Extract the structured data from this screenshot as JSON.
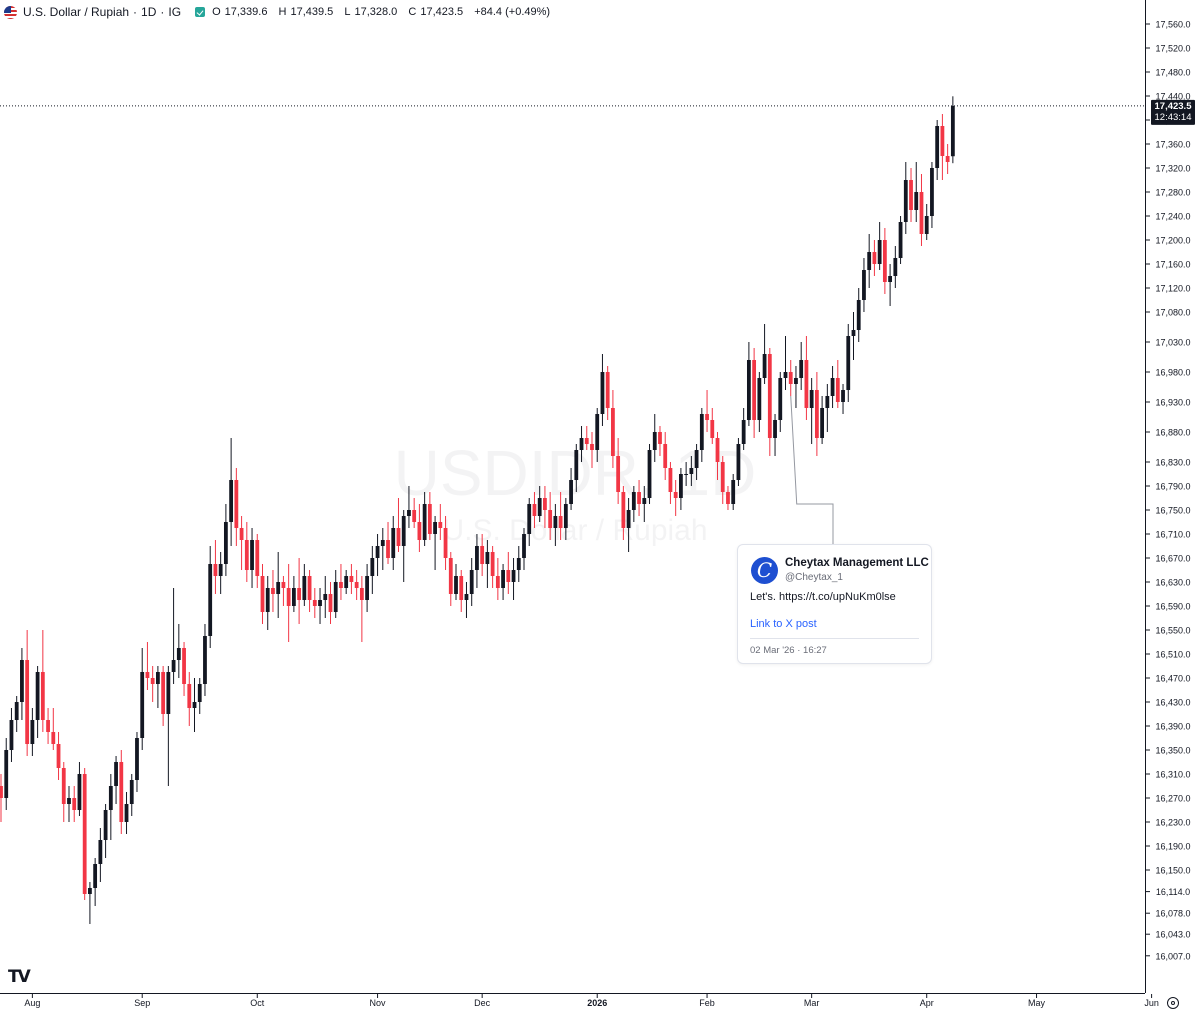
{
  "header": {
    "symbol_title": "U.S. Dollar / Rupiah",
    "interval": "1D",
    "exchange": "IG",
    "separator": "·",
    "ohlc": {
      "open_label": "O",
      "open": "17,339.6",
      "high_label": "H",
      "high": "17,439.5",
      "low_label": "L",
      "low": "17,328.0",
      "close_label": "C",
      "close": "17,423.5",
      "change": "+84.4 (+0.49%)"
    }
  },
  "watermark": {
    "symbol": "USDIDR, 1D",
    "name": "U.S. Dollar / Rupiah"
  },
  "price_label": {
    "price": "17,423.5",
    "countdown": "12:43:14"
  },
  "colors": {
    "up": "#131722",
    "down": "#f23645",
    "text": "#131722",
    "grid_axis": "#131722"
  },
  "tweet": {
    "author": "Cheytax Management LLC",
    "handle": "@Cheytax_1",
    "text": "Let's. https://t.co/upNuKm0lse",
    "link_text": "Link to X post",
    "timestamp": "02 Mar '26 · 16:27",
    "anchor_index": 151,
    "icon": "profile-c-logo"
  },
  "branding": {
    "logo_text": "TV"
  },
  "chart_data": {
    "type": "candlestick",
    "title": "U.S. Dollar / Rupiah · 1D · IG",
    "ylim": [
      15980,
      17580
    ],
    "y_scale": "linear",
    "y_ticks": [
      "17,560.0",
      "17,520.0",
      "17,480.0",
      "17,440.0",
      "17,400.0",
      "17,360.0",
      "17,320.0",
      "17,280.0",
      "17,240.0",
      "17,200.0",
      "17,160.0",
      "17,120.0",
      "17,080.0",
      "17,030.0",
      "16,980.0",
      "16,930.0",
      "16,880.0",
      "16,830.0",
      "16,790.0",
      "16,750.0",
      "16,710.0",
      "16,670.0",
      "16,630.0",
      "16,590.0",
      "16,550.0",
      "16,510.0",
      "16,470.0",
      "16,430.0",
      "16,390.0",
      "16,350.0",
      "16,310.0",
      "16,270.0",
      "16,230.0",
      "16,190.0",
      "16,150.0",
      "16,114.0",
      "16,078.0",
      "16,043.0",
      "16,007.0"
    ],
    "x_labels": [
      {
        "label": "Aug",
        "index": 6
      },
      {
        "label": "Sep",
        "index": 27
      },
      {
        "label": "Oct",
        "index": 49
      },
      {
        "label": "Nov",
        "index": 72
      },
      {
        "label": "Dec",
        "index": 92
      },
      {
        "label": "2026",
        "index": 114
      },
      {
        "label": "Feb",
        "index": 135
      },
      {
        "label": "Mar",
        "index": 155
      },
      {
        "label": "Apr",
        "index": 177
      },
      {
        "label": "May",
        "index": 198
      },
      {
        "label": "Jun",
        "index": 220
      }
    ],
    "grid": false,
    "last_price": 17423.5,
    "candles": [
      [
        16290,
        16310,
        16230,
        16270
      ],
      [
        16270,
        16370,
        16250,
        16350
      ],
      [
        16350,
        16420,
        16330,
        16400
      ],
      [
        16400,
        16440,
        16380,
        16430
      ],
      [
        16430,
        16520,
        16400,
        16500
      ],
      [
        16500,
        16550,
        16340,
        16360
      ],
      [
        16360,
        16420,
        16340,
        16400
      ],
      [
        16400,
        16490,
        16370,
        16480
      ],
      [
        16480,
        16550,
        16380,
        16400
      ],
      [
        16400,
        16420,
        16360,
        16380
      ],
      [
        16380,
        16420,
        16350,
        16360
      ],
      [
        16360,
        16380,
        16300,
        16320
      ],
      [
        16320,
        16330,
        16230,
        16260
      ],
      [
        16260,
        16290,
        16230,
        16270
      ],
      [
        16270,
        16290,
        16230,
        16250
      ],
      [
        16250,
        16330,
        16240,
        16310
      ],
      [
        16310,
        16320,
        16100,
        16110
      ],
      [
        16110,
        16130,
        16060,
        16120
      ],
      [
        16120,
        16170,
        16090,
        16160
      ],
      [
        16160,
        16220,
        16130,
        16200
      ],
      [
        16200,
        16260,
        16170,
        16250
      ],
      [
        16250,
        16310,
        16200,
        16290
      ],
      [
        16290,
        16340,
        16260,
        16330
      ],
      [
        16330,
        16350,
        16210,
        16230
      ],
      [
        16230,
        16280,
        16210,
        16260
      ],
      [
        16260,
        16310,
        16240,
        16300
      ],
      [
        16300,
        16380,
        16280,
        16370
      ],
      [
        16370,
        16520,
        16350,
        16480
      ],
      [
        16480,
        16530,
        16450,
        16470
      ],
      [
        16470,
        16490,
        16430,
        16460
      ],
      [
        16460,
        16490,
        16420,
        16480
      ],
      [
        16480,
        16490,
        16390,
        16410
      ],
      [
        16410,
        16490,
        16290,
        16480
      ],
      [
        16480,
        16620,
        16460,
        16500
      ],
      [
        16500,
        16560,
        16470,
        16520
      ],
      [
        16520,
        16530,
        16440,
        16460
      ],
      [
        16460,
        16480,
        16390,
        16420
      ],
      [
        16420,
        16470,
        16380,
        16430
      ],
      [
        16430,
        16470,
        16410,
        16460
      ],
      [
        16460,
        16560,
        16440,
        16540
      ],
      [
        16540,
        16690,
        16520,
        16660
      ],
      [
        16660,
        16700,
        16610,
        16640
      ],
      [
        16640,
        16680,
        16610,
        16660
      ],
      [
        16660,
        16760,
        16640,
        16730
      ],
      [
        16730,
        16870,
        16690,
        16800
      ],
      [
        16800,
        16820,
        16690,
        16720
      ],
      [
        16720,
        16740,
        16650,
        16700
      ],
      [
        16700,
        16730,
        16630,
        16650
      ],
      [
        16650,
        16720,
        16620,
        16700
      ],
      [
        16700,
        16710,
        16620,
        16640
      ],
      [
        16640,
        16660,
        16560,
        16580
      ],
      [
        16580,
        16640,
        16550,
        16620
      ],
      [
        16620,
        16650,
        16580,
        16610
      ],
      [
        16610,
        16680,
        16570,
        16630
      ],
      [
        16630,
        16640,
        16590,
        16620
      ],
      [
        16620,
        16660,
        16530,
        16590
      ],
      [
        16590,
        16640,
        16580,
        16620
      ],
      [
        16620,
        16670,
        16560,
        16600
      ],
      [
        16600,
        16660,
        16590,
        16640
      ],
      [
        16640,
        16650,
        16580,
        16600
      ],
      [
        16600,
        16620,
        16570,
        16590
      ],
      [
        16590,
        16620,
        16560,
        16600
      ],
      [
        16600,
        16640,
        16570,
        16610
      ],
      [
        16610,
        16630,
        16560,
        16580
      ],
      [
        16580,
        16650,
        16570,
        16630
      ],
      [
        16630,
        16660,
        16600,
        16620
      ],
      [
        16620,
        16650,
        16610,
        16640
      ],
      [
        16640,
        16660,
        16610,
        16630
      ],
      [
        16630,
        16650,
        16600,
        16620
      ],
      [
        16620,
        16640,
        16530,
        16600
      ],
      [
        16600,
        16660,
        16580,
        16640
      ],
      [
        16640,
        16690,
        16610,
        16670
      ],
      [
        16670,
        16710,
        16640,
        16690
      ],
      [
        16690,
        16720,
        16650,
        16700
      ],
      [
        16700,
        16730,
        16660,
        16670
      ],
      [
        16670,
        16740,
        16650,
        16720
      ],
      [
        16720,
        16770,
        16680,
        16690
      ],
      [
        16690,
        16750,
        16630,
        16740
      ],
      [
        16740,
        16790,
        16720,
        16750
      ],
      [
        16750,
        16770,
        16720,
        16730
      ],
      [
        16730,
        16760,
        16680,
        16700
      ],
      [
        16700,
        16780,
        16690,
        16760
      ],
      [
        16760,
        16780,
        16700,
        16710
      ],
      [
        16710,
        16740,
        16650,
        16730
      ],
      [
        16730,
        16760,
        16700,
        16720
      ],
      [
        16720,
        16740,
        16650,
        16670
      ],
      [
        16670,
        16680,
        16590,
        16610
      ],
      [
        16610,
        16660,
        16600,
        16640
      ],
      [
        16640,
        16650,
        16580,
        16600
      ],
      [
        16600,
        16630,
        16570,
        16610
      ],
      [
        16610,
        16670,
        16590,
        16650
      ],
      [
        16650,
        16710,
        16620,
        16690
      ],
      [
        16690,
        16710,
        16640,
        16660
      ],
      [
        16660,
        16700,
        16620,
        16680
      ],
      [
        16680,
        16690,
        16620,
        16640
      ],
      [
        16640,
        16670,
        16600,
        16620
      ],
      [
        16620,
        16660,
        16600,
        16650
      ],
      [
        16650,
        16680,
        16610,
        16630
      ],
      [
        16630,
        16670,
        16600,
        16650
      ],
      [
        16650,
        16690,
        16630,
        16670
      ],
      [
        16670,
        16720,
        16650,
        16710
      ],
      [
        16710,
        16770,
        16690,
        16760
      ],
      [
        16760,
        16780,
        16720,
        16740
      ],
      [
        16740,
        16790,
        16730,
        16770
      ],
      [
        16770,
        16790,
        16720,
        16750
      ],
      [
        16750,
        16780,
        16700,
        16720
      ],
      [
        16720,
        16760,
        16690,
        16740
      ],
      [
        16740,
        16780,
        16700,
        16720
      ],
      [
        16720,
        16770,
        16700,
        16760
      ],
      [
        16760,
        16820,
        16750,
        16800
      ],
      [
        16800,
        16860,
        16780,
        16850
      ],
      [
        16850,
        16890,
        16830,
        16870
      ],
      [
        16870,
        16890,
        16850,
        16860
      ],
      [
        16860,
        16880,
        16820,
        16850
      ],
      [
        16850,
        16920,
        16830,
        16910
      ],
      [
        16910,
        17010,
        16890,
        16980
      ],
      [
        16980,
        16990,
        16900,
        16920
      ],
      [
        16920,
        16950,
        16820,
        16840
      ],
      [
        16840,
        16870,
        16760,
        16780
      ],
      [
        16780,
        16790,
        16700,
        16720
      ],
      [
        16720,
        16770,
        16680,
        16750
      ],
      [
        16750,
        16790,
        16730,
        16780
      ],
      [
        16780,
        16800,
        16740,
        16760
      ],
      [
        16760,
        16790,
        16730,
        16770
      ],
      [
        16770,
        16860,
        16760,
        16850
      ],
      [
        16850,
        16910,
        16830,
        16880
      ],
      [
        16880,
        16890,
        16840,
        16860
      ],
      [
        16860,
        16880,
        16800,
        16820
      ],
      [
        16820,
        16830,
        16760,
        16780
      ],
      [
        16780,
        16800,
        16740,
        16770
      ],
      [
        16770,
        16820,
        16750,
        16810
      ],
      [
        16810,
        16830,
        16790,
        16810
      ],
      [
        16810,
        16840,
        16790,
        16820
      ],
      [
        16820,
        16860,
        16800,
        16850
      ],
      [
        16850,
        16920,
        16830,
        16910
      ],
      [
        16910,
        16950,
        16880,
        16900
      ],
      [
        16900,
        16920,
        16860,
        16870
      ],
      [
        16870,
        16880,
        16800,
        16830
      ],
      [
        16830,
        16840,
        16760,
        16780
      ],
      [
        16780,
        16790,
        16750,
        16760
      ],
      [
        16760,
        16810,
        16750,
        16800
      ],
      [
        16800,
        16870,
        16790,
        16860
      ],
      [
        16860,
        16920,
        16850,
        16900
      ],
      [
        16900,
        17030,
        16890,
        17000
      ],
      [
        17000,
        17020,
        16870,
        16900
      ],
      [
        16900,
        16980,
        16880,
        16970
      ],
      [
        16970,
        17060,
        16960,
        17010
      ],
      [
        17010,
        17020,
        16840,
        16870
      ],
      [
        16870,
        16910,
        16840,
        16900
      ],
      [
        16900,
        16980,
        16880,
        16970
      ],
      [
        16970,
        17040,
        16950,
        16980
      ],
      [
        16980,
        17000,
        16940,
        16960
      ],
      [
        16960,
        16990,
        16920,
        16970
      ],
      [
        16970,
        17030,
        16950,
        17000
      ],
      [
        17000,
        17040,
        16900,
        16920
      ],
      [
        16920,
        16970,
        16860,
        16950
      ],
      [
        16950,
        16980,
        16840,
        16870
      ],
      [
        16870,
        16940,
        16860,
        16920
      ],
      [
        16920,
        16960,
        16880,
        16940
      ],
      [
        16940,
        16990,
        16920,
        16970
      ],
      [
        16970,
        17000,
        16920,
        16930
      ],
      [
        16930,
        16960,
        16910,
        16950
      ],
      [
        16950,
        17060,
        16930,
        17040
      ],
      [
        17040,
        17080,
        17000,
        17050
      ],
      [
        17050,
        17120,
        17030,
        17100
      ],
      [
        17100,
        17170,
        17080,
        17150
      ],
      [
        17150,
        17210,
        17120,
        17180
      ],
      [
        17180,
        17200,
        17140,
        17160
      ],
      [
        17160,
        17230,
        17150,
        17200
      ],
      [
        17200,
        17220,
        17110,
        17130
      ],
      [
        17130,
        17160,
        17090,
        17140
      ],
      [
        17140,
        17190,
        17120,
        17170
      ],
      [
        17170,
        17240,
        17160,
        17230
      ],
      [
        17230,
        17330,
        17210,
        17300
      ],
      [
        17300,
        17320,
        17230,
        17250
      ],
      [
        17250,
        17330,
        17230,
        17280
      ],
      [
        17280,
        17310,
        17190,
        17210
      ],
      [
        17210,
        17260,
        17200,
        17240
      ],
      [
        17240,
        17330,
        17220,
        17320
      ],
      [
        17320,
        17400,
        17300,
        17390
      ],
      [
        17390,
        17410,
        17300,
        17340
      ],
      [
        17340,
        17360,
        17310,
        17330
      ],
      [
        17339.6,
        17439.5,
        17328.0,
        17423.5
      ]
    ]
  }
}
